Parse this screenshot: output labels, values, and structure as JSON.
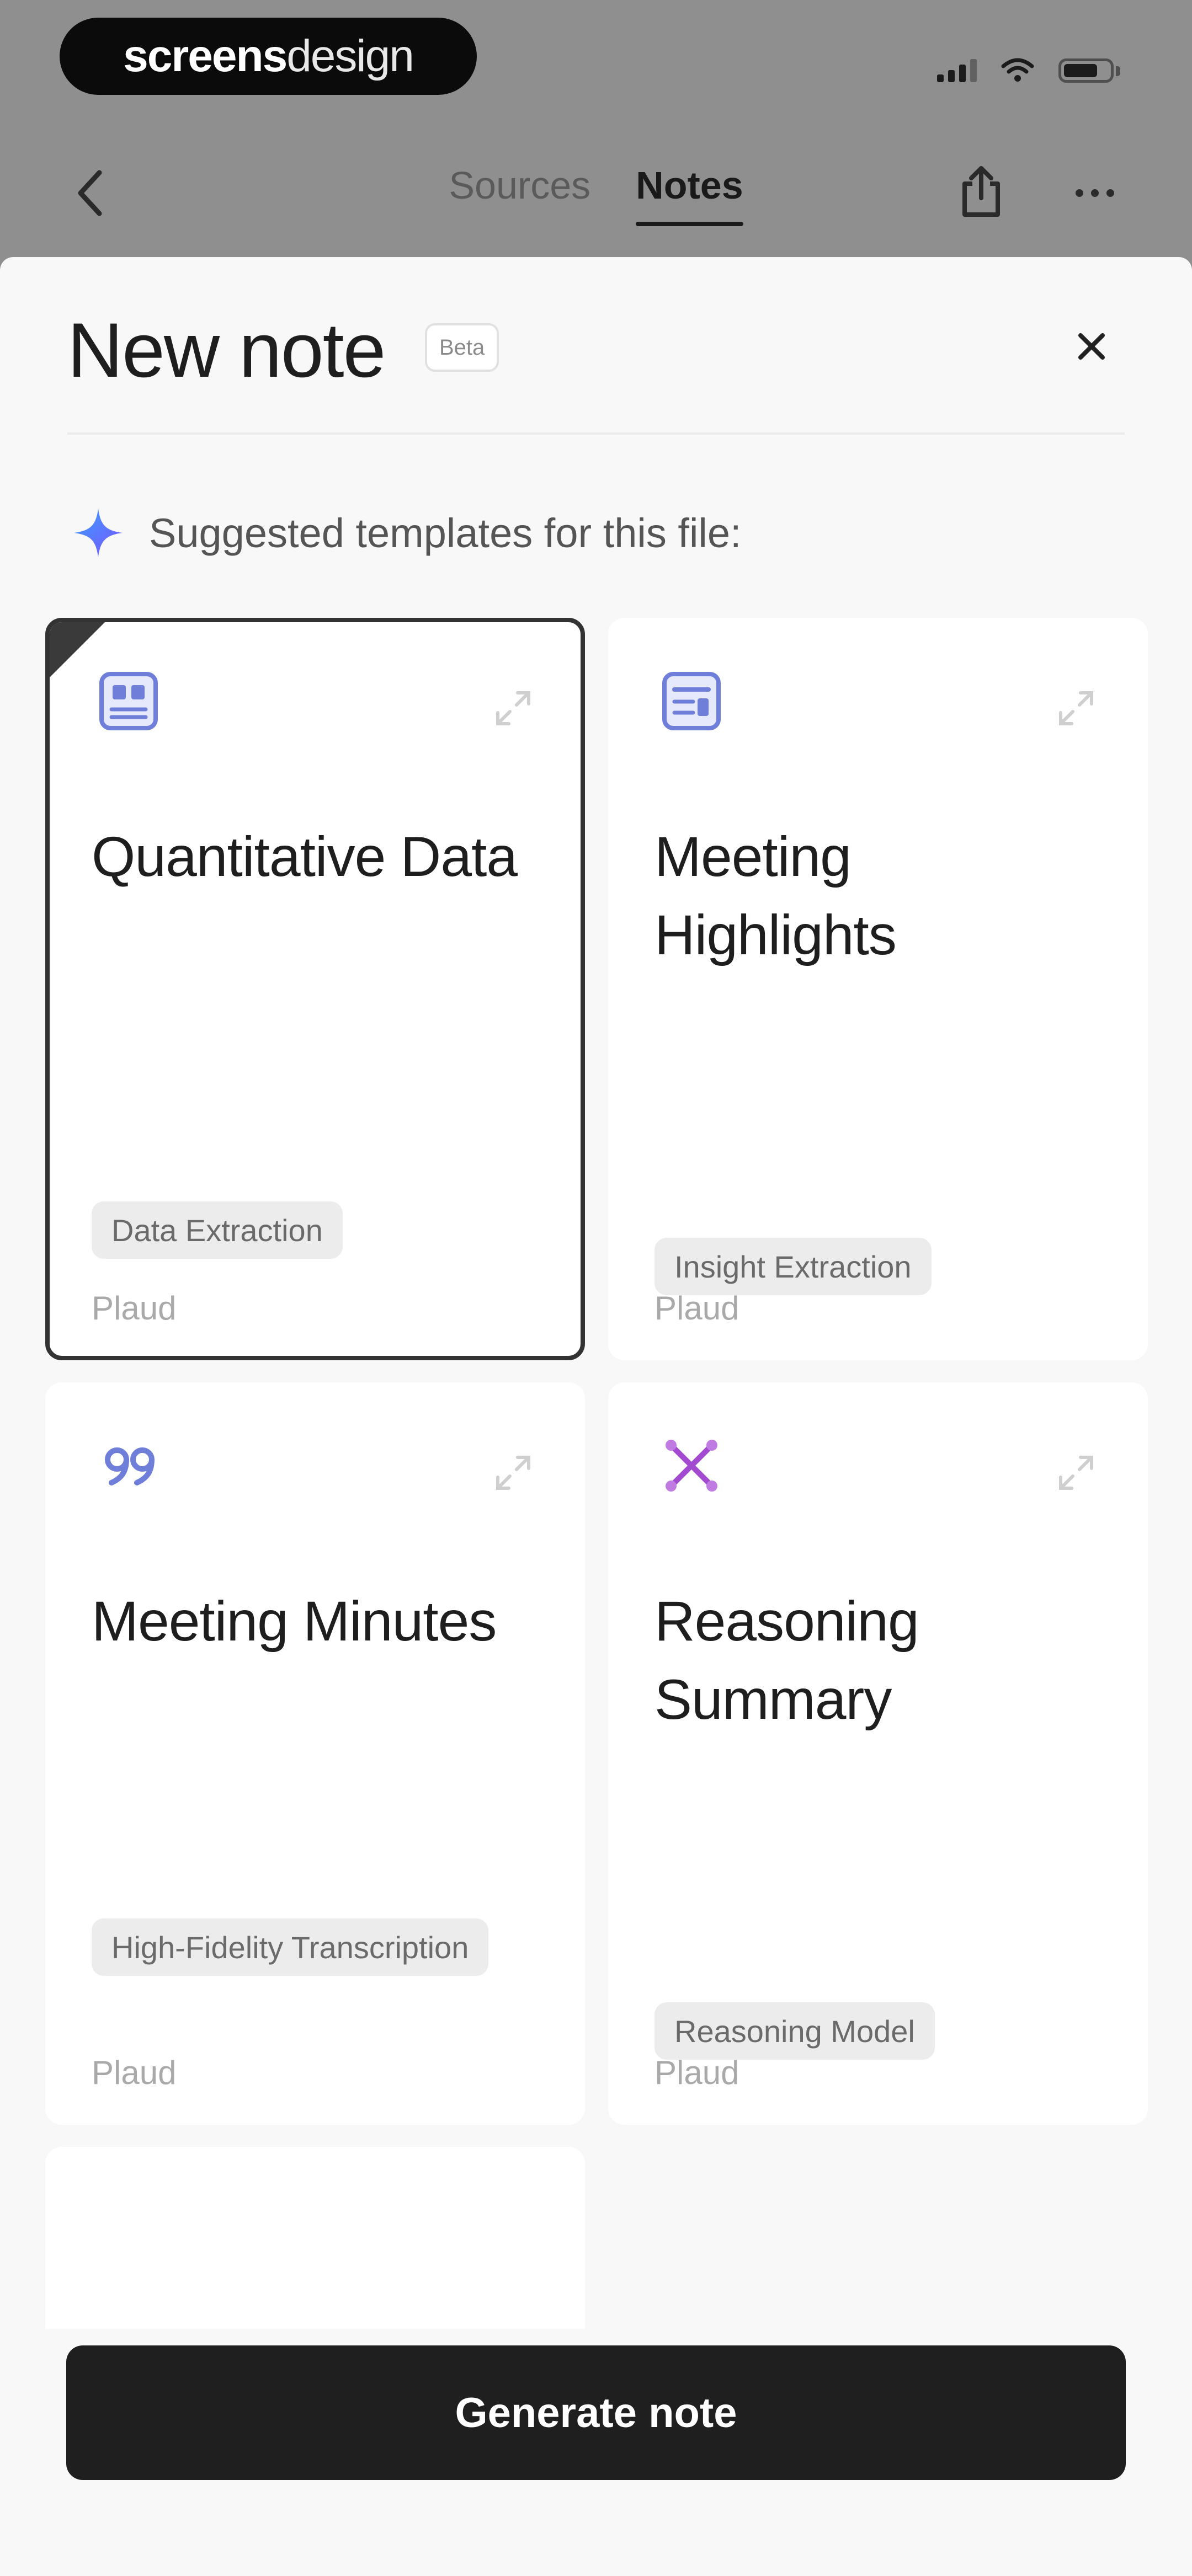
{
  "brand": {
    "bold": "screens",
    "light": "design"
  },
  "nav": {
    "tabs": [
      {
        "label": "Sources",
        "active": false
      },
      {
        "label": "Notes",
        "active": true
      }
    ]
  },
  "sheet": {
    "title": "New note",
    "badge": "Beta",
    "suggest_label": "Suggested templates for this file:"
  },
  "templates": [
    {
      "title": "Quantitative Data",
      "tag": "Data Extraction",
      "author": "Plaud",
      "icon": "data-table-icon",
      "selected": true
    },
    {
      "title": "Meeting Highlights",
      "tag": "Insight Extraction",
      "author": "Plaud",
      "icon": "document-list-icon",
      "selected": false
    },
    {
      "title": "Meeting Minutes",
      "tag": "High-Fidelity Transcription",
      "author": "Plaud",
      "icon": "quote-icon",
      "selected": false
    },
    {
      "title": "Reasoning Summary",
      "tag": "Reasoning Model",
      "author": "Plaud",
      "icon": "reasoning-x-icon",
      "selected": false
    }
  ],
  "actions": {
    "generate_label": "Generate note"
  },
  "colors": {
    "accent_blue": "#6f7fd9",
    "accent_purple": "#a24ad0",
    "sparkle_start": "#3aa0ff",
    "sparkle_end": "#7a52ff",
    "button": "#1f1f1f"
  }
}
